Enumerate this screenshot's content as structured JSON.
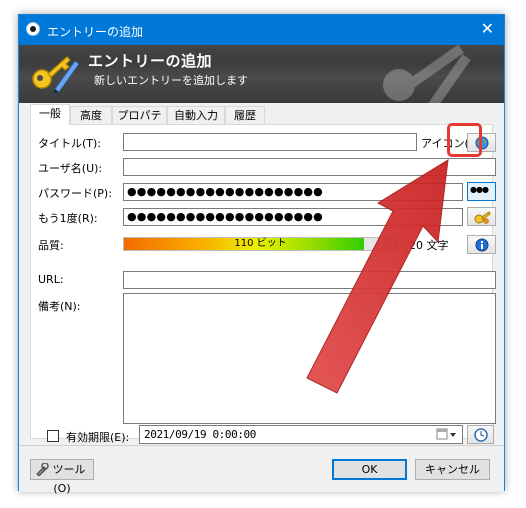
{
  "window": {
    "title": "エントリーの追加",
    "close_glyph": "✕"
  },
  "banner": {
    "heading": "エントリーの追加",
    "subheading": "新しいエントリーを追加します"
  },
  "tabs": [
    "一般",
    "高度",
    "プロパティ",
    "自動入力",
    "履歴"
  ],
  "form": {
    "title_label": "タイトル(T):",
    "title_value": "",
    "icon_label": "アイコン(I):",
    "username_label": "ユーザ名(U):",
    "username_value": "",
    "password_label": "パスワード(P):",
    "password_mask": "●●●●●●●●●●●●●●●●●●●●",
    "repeat_label": "もう1度(R):",
    "repeat_mask": "●●●●●●●●●●●●●●●●●●●●",
    "quality_label": "品質:",
    "quality_text": "110 ビット",
    "quality_fraction": 0.88,
    "char_count": "20 文字",
    "url_label": "URL:",
    "url_value": "",
    "notes_label": "備考(N):",
    "notes_value": "",
    "expires_label": "有効期限(E):",
    "expires_checked": false,
    "expires_value": "2021/09/19   0:00:00"
  },
  "buttons": {
    "show_password": "●●●",
    "tools": "ツール(O)",
    "ok": "OK",
    "cancel": "キャンセル"
  },
  "colors": {
    "titlebar": "#0078d7",
    "highlight": "#e53935",
    "arrow": "#d42c2c"
  },
  "icons": [
    "keepass-app-icon",
    "key-pencil-icon",
    "world-icon",
    "dots-icon",
    "key-generator-icon",
    "info-icon",
    "calendar-dropdown-icon",
    "clock-icon",
    "tools-icon"
  ]
}
